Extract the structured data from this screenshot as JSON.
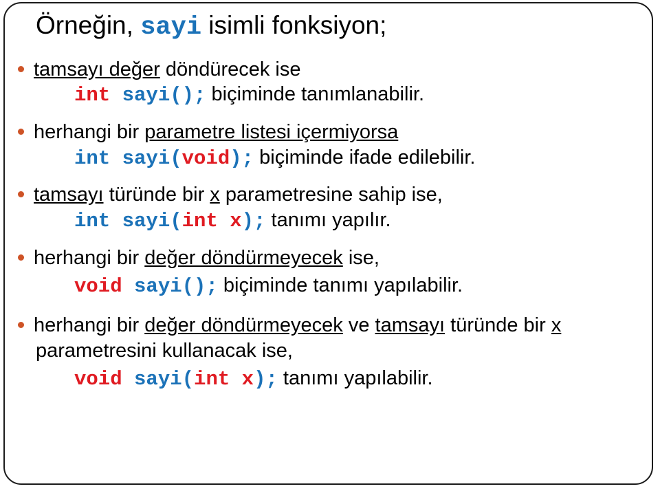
{
  "slide": {
    "language": "tr",
    "background_color": "#FFFFFF",
    "frame_border_color": "#1A1A1A",
    "bullet_color": "#CE5326",
    "keyword_color": "#E01B22",
    "identifier_color": "#1B72B8",
    "text_color": "#000000",
    "title": {
      "part1": "Örneğin, ",
      "code": "sayi",
      "part2": " isimli fonksiyon;"
    },
    "bullets": [
      {
        "id": "bullet-1",
        "text_underlined": "tamsayı değer",
        "text_rest": " döndürecek ise",
        "code_line": {
          "tokens": [
            {
              "text": "int",
              "color": "red",
              "mono": true
            },
            {
              "text": " ",
              "color": "black",
              "mono": true
            },
            {
              "text": "sayi();",
              "color": "blue",
              "mono": true
            }
          ],
          "trailing_text": "  biçiminde tanımlanabilir."
        }
      },
      {
        "id": "bullet-2",
        "text_pre": "herhangi bir ",
        "text_underlined": "parametre listesi içermiyorsa",
        "text_rest": "",
        "code_line": {
          "tokens": [
            {
              "text": "int sayi(",
              "color": "blue",
              "mono": true
            },
            {
              "text": "void",
              "color": "red",
              "mono": true
            },
            {
              "text": ");",
              "color": "blue",
              "mono": true
            }
          ],
          "trailing_text": "  biçiminde ifade edilebilir."
        }
      },
      {
        "id": "bullet-3",
        "text_underlined": "tamsayı",
        "text_mid": " türünde bir ",
        "text_underlined2": "x",
        "text_rest": " parametresine sahip ise,",
        "code_line": {
          "tokens": [
            {
              "text": "int sayi(",
              "color": "blue",
              "mono": true
            },
            {
              "text": "int x",
              "color": "red",
              "mono": true
            },
            {
              "text": ");",
              "color": "blue",
              "mono": true
            }
          ],
          "trailing_text": "  tanımı yapılır."
        }
      },
      {
        "id": "bullet-4",
        "text_pre": "herhangi bir ",
        "text_underlined": "değer döndürmeyecek",
        "text_rest": " ise,",
        "code_line": {
          "tokens": [
            {
              "text": "void",
              "color": "red",
              "mono": true
            },
            {
              "text": " ",
              "color": "black",
              "mono": true
            },
            {
              "text": "sayi();",
              "color": "blue",
              "mono": true
            }
          ],
          "trailing_text": "  biçiminde tanımı yapılabilir."
        }
      },
      {
        "id": "bullet-5",
        "text_pre": "herhangi bir ",
        "text_underlined": "değer döndürmeyecek",
        "text_mid": " ve ",
        "text_underlined2": "tamsayı",
        "text_mid2": " türünde bir ",
        "text_underlined3": "x",
        "text_wrap": "parametresini kullanacak ise,",
        "code_line": {
          "tokens": [
            {
              "text": "void",
              "color": "red",
              "mono": true
            },
            {
              "text": " ",
              "color": "black",
              "mono": true
            },
            {
              "text": "sayi(",
              "color": "blue",
              "mono": true
            },
            {
              "text": "int x",
              "color": "red",
              "mono": true
            },
            {
              "text": ");",
              "color": "blue",
              "mono": true
            }
          ],
          "trailing_text": "  tanımı yapılabilir."
        }
      }
    ]
  }
}
